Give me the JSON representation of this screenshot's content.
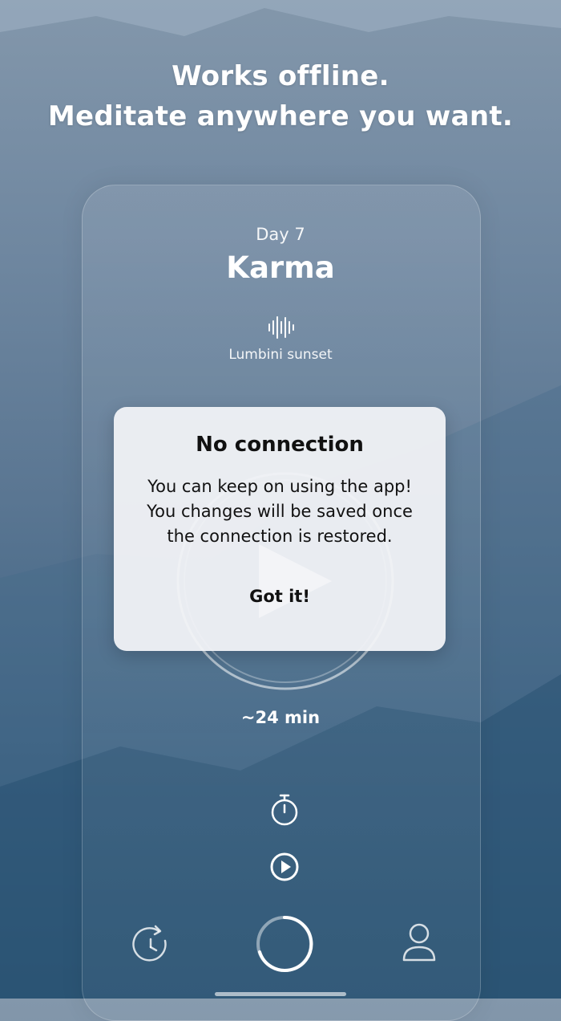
{
  "headline": {
    "line1": "Works offline.",
    "line2": "Meditate anywhere you want."
  },
  "session": {
    "day_label": "Day 7",
    "title": "Karma",
    "sound_icon": "sound-wave-icon",
    "sound_label": "Lumbini sunset",
    "duration": "~24 min"
  },
  "controls": {
    "timer_icon": "stopwatch-icon",
    "autoplay_icon": "play-circle-icon"
  },
  "nav": {
    "history_icon": "history-icon",
    "home_icon": "meditate-ring-icon",
    "profile_icon": "user-icon"
  },
  "dialog": {
    "title": "No connection",
    "message": [
      "You can keep on using the app!",
      "You changes will be saved once",
      "the connection is restored."
    ],
    "button_label": "Got it!"
  },
  "colors": {
    "bg_top": "#8397ab",
    "bg_bottom": "#27506f",
    "dialog_bg": "#f2f3f7",
    "text_light": "#ffffff",
    "text_dark": "#111111"
  }
}
